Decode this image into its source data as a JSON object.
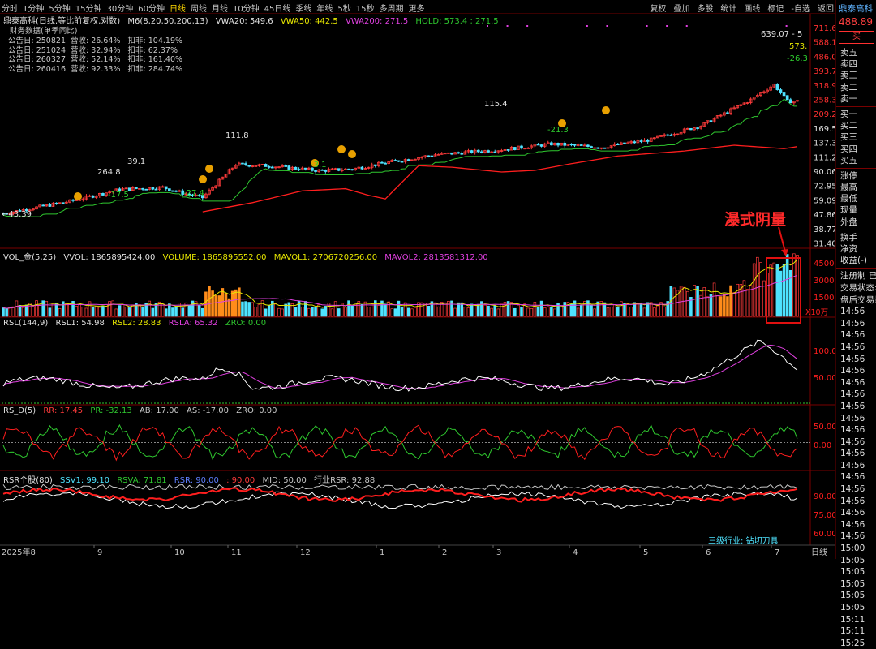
{
  "topbar": {
    "periods": [
      "分时",
      "1分钟",
      "5分钟",
      "15分钟",
      "30分钟",
      "60分钟",
      "日线",
      "周线",
      "月线",
      "10分钟",
      "45日线",
      "季线",
      "年线",
      "5秒",
      "15秒",
      "多周期",
      "更多"
    ],
    "active_period": "日线",
    "tools": [
      "复权",
      "叠加",
      "多股",
      "统计",
      "画线",
      "标记",
      "-自选",
      "返回"
    ]
  },
  "main_panel": {
    "legend": {
      "name": "鼎泰高科(日线,等比前复权,对数)",
      "indicator": "M6(8,20,50,200,13)",
      "vwa20": "VWA20: 549.6",
      "vwa50": "VWA50: 442.5",
      "vwa200": "VWA200: 271.5",
      "hold": "HOLD: 573.4 ; 271.5"
    },
    "financials": {
      "title": "财务数据(单季同比)",
      "rows": [
        "公告日: 250821  营收: 26.64%   扣非: 104.19%",
        "公告日: 251024  营收: 32.94%   扣非: 62.37%",
        "公告日: 260327  营收: 52.14%   扣非: 161.40%",
        "公告日: 260416  营收: 92.33%   扣非: 284.74%"
      ]
    },
    "price_labels": [
      {
        "text": "←43.39",
        "color": "#e0e0e0"
      },
      {
        "text": "264.8",
        "color": "#e0e0e0"
      },
      {
        "text": "-17.5",
        "color": "#2fd02f"
      },
      {
        "text": "39.1",
        "color": "#e0e0e0"
      },
      {
        "text": "-27.4",
        "color": "#2fd02f"
      },
      {
        "text": "111.8",
        "color": "#e0e0e0"
      },
      {
        "text": "-3.1",
        "color": "#2fd02f"
      },
      {
        "text": "115.4",
        "color": "#e0e0e0"
      },
      {
        "text": "-21.3",
        "color": "#2fd02f"
      },
      {
        "text": "639.07 - 5",
        "color": "#e0e0e0"
      },
      {
        "text": "573.",
        "color": "#e8e800"
      },
      {
        "text": "-26.3",
        "color": "#2fd02f"
      }
    ],
    "axis_ticks": [
      "711.6",
      "588.1",
      "486.0",
      "393.7",
      "318.9",
      "258.3",
      "209.2",
      "169.5",
      "137.3",
      "111.2",
      "90.06",
      "72.95",
      "59.09",
      "47.86",
      "38.77",
      "31.40"
    ],
    "axis_label_colors": {
      "red": "#ff3030",
      "white": "#e0e0e0"
    }
  },
  "volume_panel": {
    "legend": {
      "name": "VOL_金(5,25)",
      "vvol": "VVOL: 1865895424.00",
      "volume": "VOLUME: 1865895552.00",
      "mavol1": "MAVOL1: 2706720256.00",
      "mavol2": "MAVOL2: 2813581312.00"
    },
    "axis_ticks": [
      "45000",
      "30000",
      "15000"
    ],
    "unit": "X10万"
  },
  "rsl_panel": {
    "legend": {
      "name": "RSL(144,9)",
      "rsl1": "RSL1: 54.98",
      "rsl2": "RSL2: 28.83",
      "rsla": "RSLA: 65.32",
      "zro": "ZRO: 0.00"
    },
    "axis_ticks": [
      "100.0",
      "50.00"
    ]
  },
  "rsd_panel": {
    "legend": {
      "name": "RS_D(5)",
      "rr": "RR: 17.45",
      "pr": "PR: -32.13",
      "ab": "AB: 17.00",
      "as": "AS: -17.00",
      "zro": "ZRO: 0.00"
    },
    "axis_ticks": [
      "50.00",
      "0.00"
    ]
  },
  "rsr_panel": {
    "legend": {
      "name": "RSR个股(80)",
      "ssv1": "SSV1: 99.10",
      "rsva": "RSVA: 71.81",
      "rsr": "RSR: 90.00",
      "n90": ": 90.00",
      "mid": "MID: 50.00",
      "industry": "行业RSR: 92.88"
    },
    "axis_ticks": [
      "90.00",
      "75.00",
      "60.00"
    ],
    "industry_note": "三级行业: 钻切刀具"
  },
  "x_axis": {
    "labels": [
      "2025年8",
      "9",
      "10",
      "11",
      "12",
      "1",
      "2",
      "3",
      "4",
      "5",
      "6",
      "7"
    ],
    "period_label": "日线"
  },
  "annotation": {
    "text": "瀑式阴量"
  },
  "sidebar": {
    "stock_name": "鼎泰高科",
    "price": "488.89",
    "buy_button": "买",
    "order_book": [
      "卖五",
      "卖四",
      "卖三",
      "卖二",
      "卖一",
      "买一",
      "买二",
      "买三",
      "买四",
      "买五"
    ],
    "quote_fields": [
      "涨停",
      "最高",
      "最低",
      "现量",
      "外盘"
    ],
    "extra_fields": [
      "换手",
      "净资",
      "收益(-)"
    ],
    "status_lines": [
      "注册制 已",
      "交易状态:",
      "盘后交易量"
    ],
    "times": [
      "14:56",
      "14:56",
      "14:56",
      "14:56",
      "14:56",
      "14:56",
      "14:56",
      "14:56",
      "14:56",
      "14:56",
      "14:56",
      "14:56",
      "14:56",
      "14:56",
      "14:56",
      "14:56",
      "14:56",
      "14:56",
      "14:56",
      "14:56",
      "15:00",
      "15:05",
      "15:05",
      "15:05",
      "15:05",
      "15:05",
      "15:11",
      "15:11",
      "15:25"
    ]
  },
  "colors": {
    "up": "#ff3b3b",
    "down": "#4fe3ff",
    "ma_green": "#2fc82f",
    "ma_red": "#ff1e1e",
    "yellow": "#e8e800",
    "magenta": "#e040e0",
    "orange": "#ff8c1a",
    "gold": "#ffd700",
    "grid": "#7a0000"
  }
}
